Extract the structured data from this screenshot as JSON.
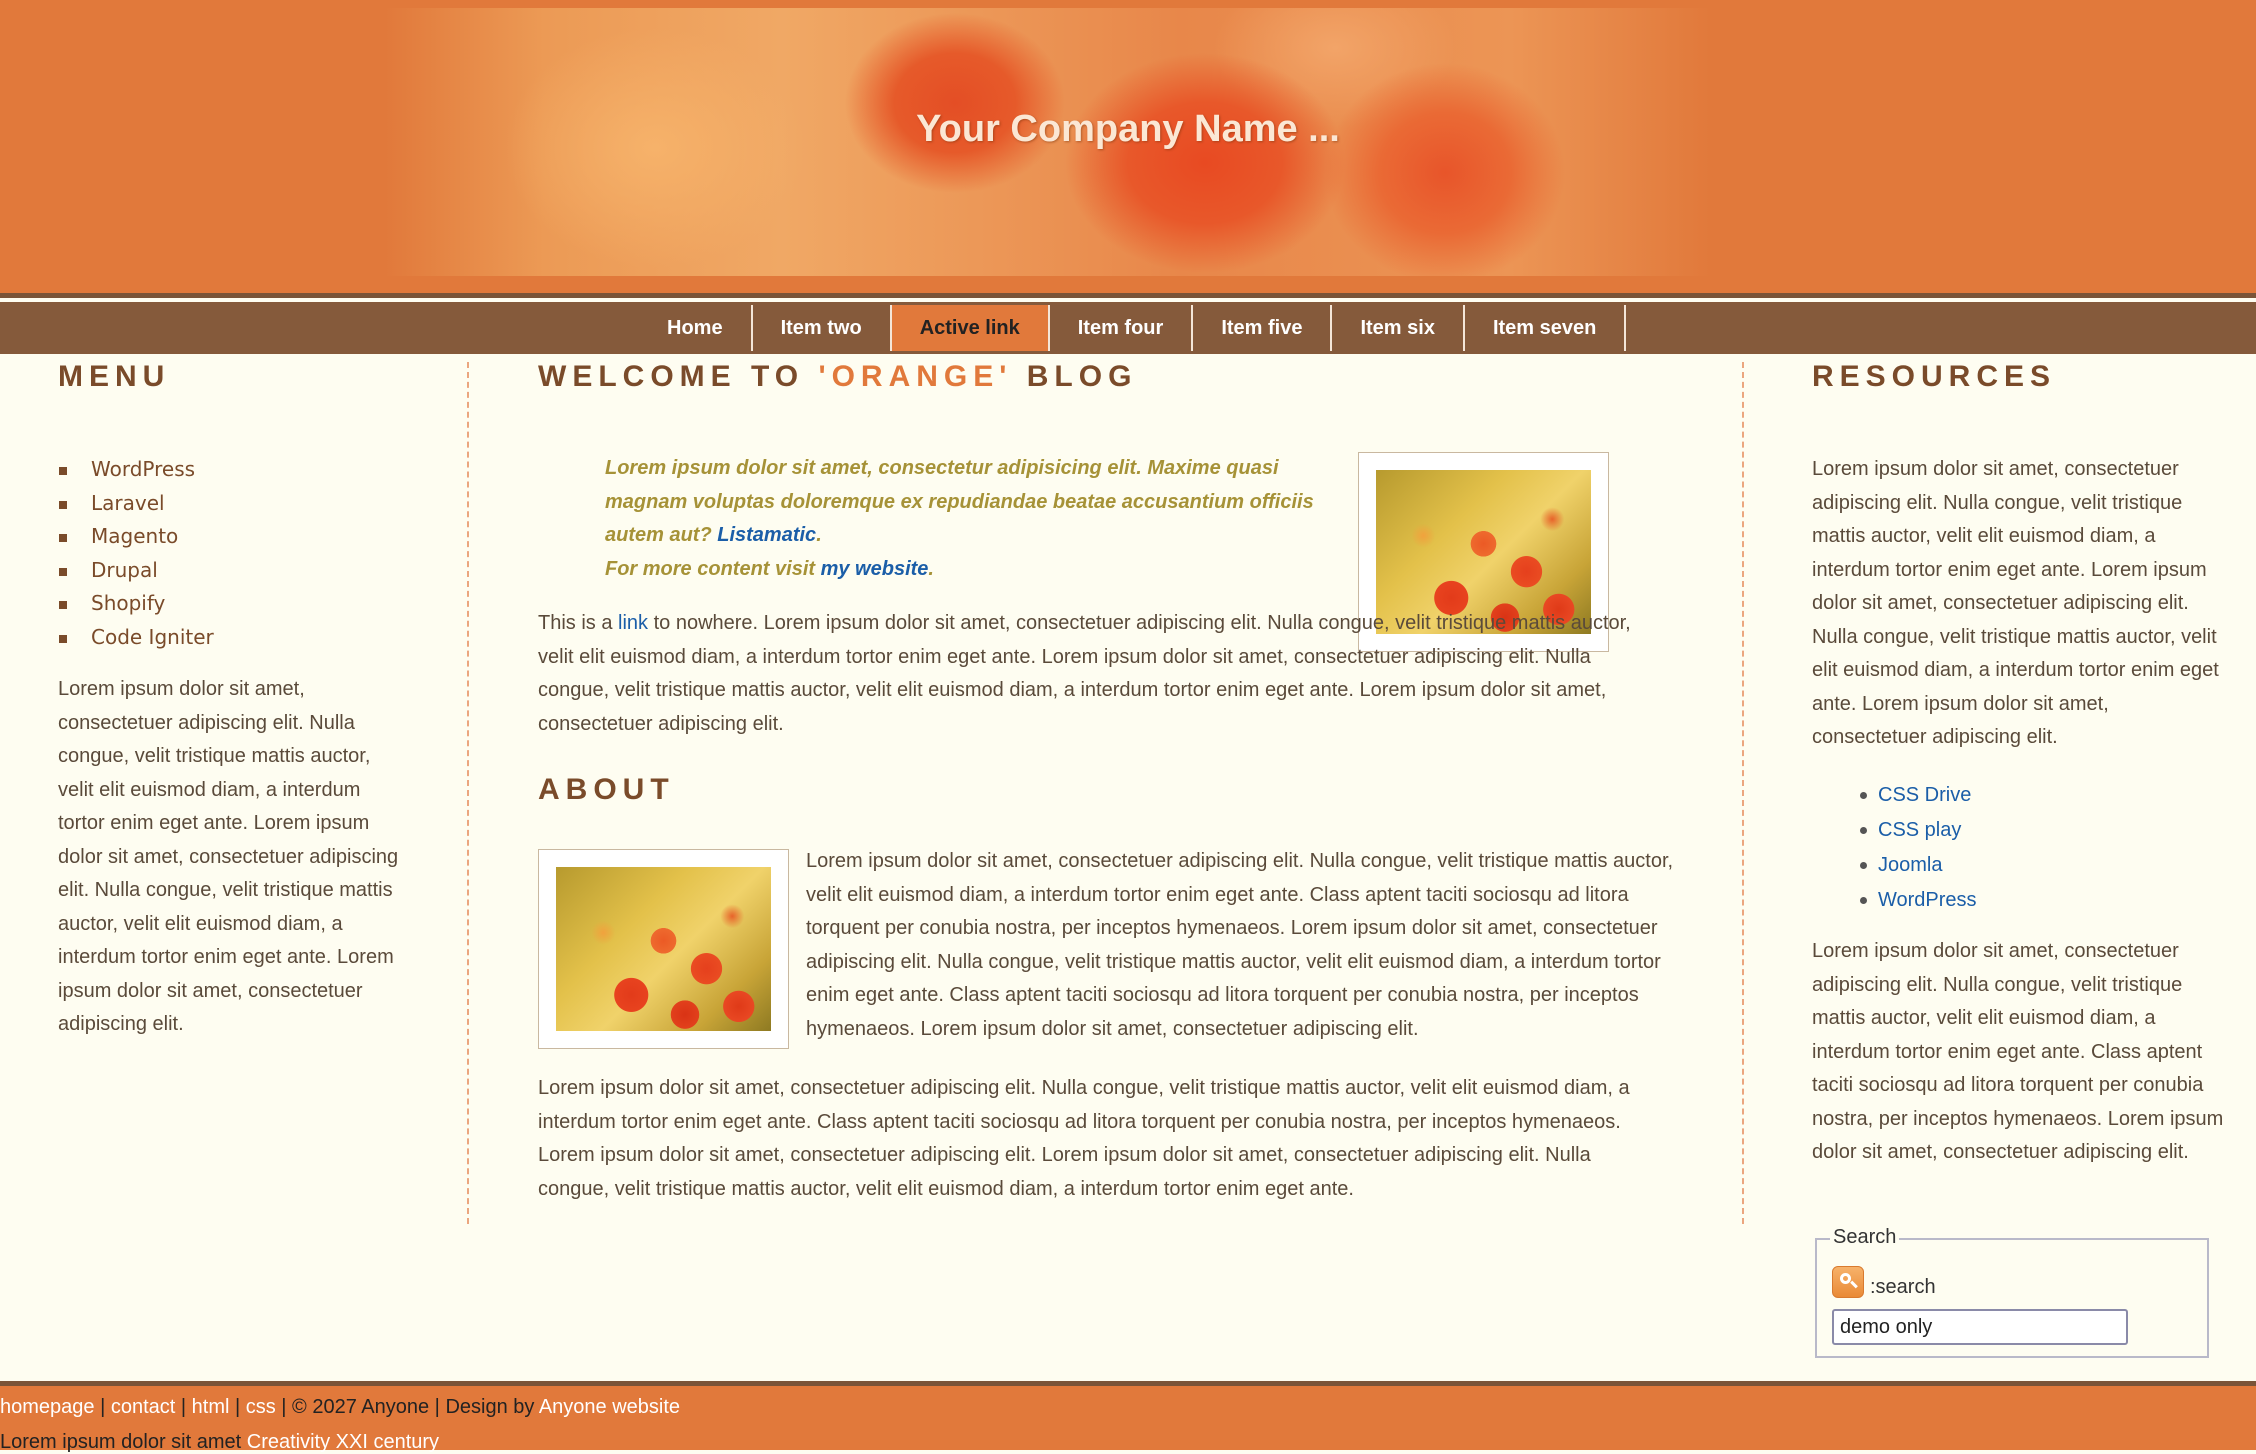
{
  "header": {
    "title": "Your Company Name ..."
  },
  "nav": {
    "items": [
      {
        "label": "Home",
        "active": false
      },
      {
        "label": "Item two",
        "active": false
      },
      {
        "label": "Active link",
        "active": true
      },
      {
        "label": "Item four",
        "active": false
      },
      {
        "label": "Item five",
        "active": false
      },
      {
        "label": "Item six",
        "active": false
      },
      {
        "label": "Item seven",
        "active": false
      }
    ]
  },
  "left": {
    "title": "MENU",
    "menu": [
      "WordPress",
      "Laravel",
      "Magento",
      "Drupal",
      "Shopify",
      "Code Igniter"
    ],
    "text": "Lorem ipsum dolor sit amet, consectetuer adipiscing elit. Nulla congue, velit tristique mattis auctor, velit elit euismod diam, a interdum tortor enim eget ante. Lorem ipsum dolor sit amet, consectetuer adipiscing elit. Nulla congue, velit tristique mattis auctor, velit elit euismod diam, a interdum tortor enim eget ante. Lorem ipsum dolor sit amet, consectetuer adipiscing elit."
  },
  "main": {
    "title_prefix": "WELCOME TO ",
    "title_highlight": "'ORANGE'",
    "title_suffix": " BLOG",
    "quote_text": "Lorem ipsum dolor sit amet, consectetur adipisicing elit. Maxime quasi magnam voluptas doloremque ex repudiandae beatae accusantium officiis autem aut? ",
    "quote_link": "Listamatic",
    "quote_period": ".",
    "quote_more": "For more content visit ",
    "quote_more_link": "my website",
    "quote_more_period": ".",
    "intro_before_link": "This is a ",
    "intro_link": "link",
    "intro_after_link": " to nowhere. Lorem ipsum dolor sit amet, consectetuer adipiscing elit. Nulla congue, velit tristique mattis auctor, velit elit euismod diam, a interdum tortor enim eget ante. Lorem ipsum dolor sit amet, consectetuer adipiscing elit. Nulla congue, velit tristique mattis auctor, velit elit euismod diam, a interdum tortor enim eget ante. Lorem ipsum dolor sit amet, consectetuer adipiscing elit.",
    "about_title": "ABOUT",
    "about_para1": "Lorem ipsum dolor sit amet, consectetuer adipiscing elit. Nulla congue, velit tristique mattis auctor, velit elit euismod diam, a interdum tortor enim eget ante. Class aptent taciti sociosqu ad litora torquent per conubia nostra, per inceptos hymenaeos. Lorem ipsum dolor sit amet, consectetuer adipiscing elit. Nulla congue, velit tristique mattis auctor, velit elit euismod diam, a interdum tortor enim eget ante. Class aptent taciti sociosqu ad litora torquent per conubia nostra, per inceptos hymenaeos. Lorem ipsum dolor sit amet, consectetuer adipiscing elit.",
    "about_para2": "Lorem ipsum dolor sit amet, consectetuer adipiscing elit. Nulla congue, velit tristique mattis auctor, velit elit euismod diam, a interdum tortor enim eget ante. Class aptent taciti sociosqu ad litora torquent per conubia nostra, per inceptos hymenaeos. Lorem ipsum dolor sit amet, consectetuer adipiscing elit. Lorem ipsum dolor sit amet, consectetuer adipiscing elit. Nulla congue, velit tristique mattis auctor, velit elit euismod diam, a interdum tortor enim eget ante."
  },
  "right": {
    "title": "RESOURCES",
    "text1": "Lorem ipsum dolor sit amet, consectetuer adipiscing elit. Nulla congue, velit tristique mattis auctor, velit elit euismod diam, a interdum tortor enim eget ante. Lorem ipsum dolor sit amet, consectetuer adipiscing elit. Nulla congue, velit tristique mattis auctor, velit elit euismod diam, a interdum tortor enim eget ante. Lorem ipsum dolor sit amet, consectetuer adipiscing elit.",
    "links": [
      "CSS Drive",
      "CSS play",
      "Joomla",
      "WordPress"
    ],
    "text2": "Lorem ipsum dolor sit amet, consectetuer adipiscing elit. Nulla congue, velit tristique mattis auctor, velit elit euismod diam, a interdum tortor enim eget ante. Class aptent taciti sociosqu ad litora torquent per conubia nostra, per inceptos hymenaeos. Lorem ipsum dolor sit amet, consectetuer adipiscing elit.",
    "search": {
      "legend": "Search",
      "label": ":search",
      "icon": "search-icon",
      "value": "demo only"
    }
  },
  "footer": {
    "links": [
      "homepage",
      "contact",
      "html",
      "css"
    ],
    "separator": " | ",
    "copyright": " | © 2027 Anyone | Design by ",
    "designer_link": "Anyone website",
    "line2_text": "Lorem ipsum dolor sit amet ",
    "line2_link": "Creativity XXI century"
  },
  "colors": {
    "orange": "#e1793b",
    "brown": "#855a3b",
    "heading": "#7a4b2a",
    "quote": "#a69237",
    "link": "#1b5ea8",
    "background": "#fefdf1"
  }
}
